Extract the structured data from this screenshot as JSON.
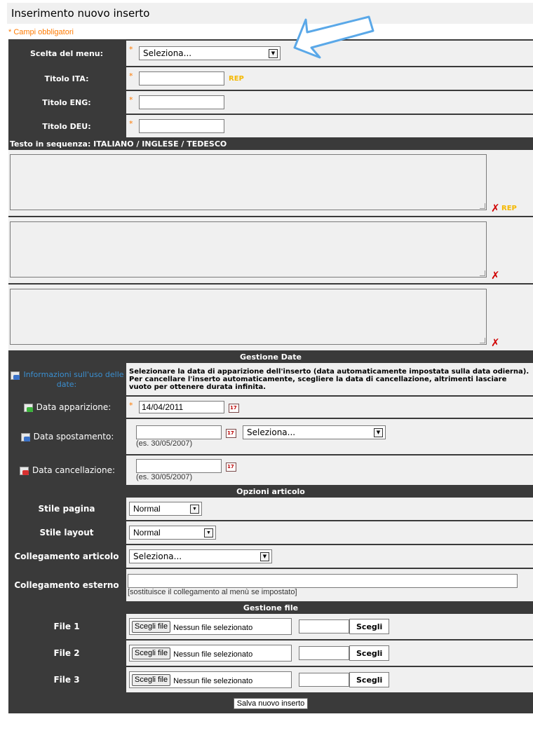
{
  "page_title": "Inserimento nuovo inserto",
  "required_note": "* Campi obbligatori",
  "required_mark": "*",
  "menu": {
    "label": "Scelta del menu:",
    "value": "Seleziona..."
  },
  "titles": {
    "ita_label": "Titolo ITA:",
    "eng_label": "Titolo ENG:",
    "deu_label": "Titolo DEU:",
    "ita_value": "",
    "eng_value": "",
    "deu_value": "",
    "rep": "REP"
  },
  "text_section": {
    "header": "Testo in sequenza: ITALIANO / INGLESE / TEDESCO",
    "delete_mark": "✗",
    "rep": "REP"
  },
  "dates": {
    "header": "Gestione Date",
    "info_label": "Informazioni sull'uso delle date:",
    "info_text": "Selezionare la data di apparizione dell'inserto (data automaticamente impostata sulla data odierna). Per cancellare l'inserto automaticamente, scegliere la data di cancellazione, altrimenti lasciare vuoto per ottenere durata infinita.",
    "appear_label": "Data apparizione:",
    "appear_value": "14/04/2011",
    "move_label": "Data spostamento:",
    "move_value": "",
    "move_select": "Seleziona...",
    "move_hint": "(es. 30/05/2007)",
    "delete_label": "Data cancellazione:",
    "delete_value": "",
    "delete_hint": "(es. 30/05/2007)"
  },
  "options": {
    "header": "Opzioni articolo",
    "page_style_label": "Stile pagina",
    "page_style_value": "Normal",
    "layout_style_label": "Stile layout",
    "layout_style_value": "Normal",
    "article_link_label": "Collegamento articolo",
    "article_link_value": "Seleziona...",
    "external_link_label": "Collegamento esterno",
    "external_link_value": "",
    "external_link_hint": "[sostituisce il collegamento al menù se impostato]"
  },
  "files": {
    "header": "Gestione file",
    "choose_file": "Scegli file",
    "no_file": "Nessun file selezionato",
    "pick": "Scegli",
    "items": [
      {
        "label": "File 1"
      },
      {
        "label": "File 2"
      },
      {
        "label": "File 3"
      }
    ]
  },
  "submit_label": "Salva nuovo inserto",
  "colors": {
    "accent": "#ff7a00",
    "rep": "#f5b800",
    "header_bg": "#3a3a3a",
    "row_bg": "#f0f0f0",
    "arrow": "#5aa8e8"
  },
  "icons": [
    "calendar-icon",
    "info-icon",
    "date-appear-icon",
    "date-move-icon",
    "date-delete-icon",
    "dropdown-arrow-icon"
  ]
}
